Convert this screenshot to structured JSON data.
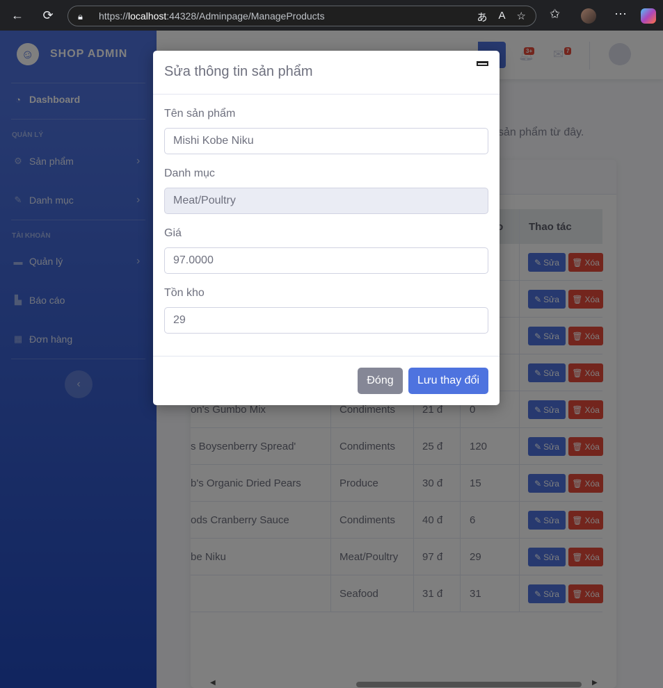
{
  "browser": {
    "url_prefix": "https://",
    "url_host": "localhost",
    "url_rest": ":44328/Adminpage/ManageProducts"
  },
  "sidebar": {
    "brand": "SHOP ADMIN",
    "dashboard": "Dashboard",
    "heading_manage": "QUẢN LÝ",
    "products": "Sản phẩm",
    "categories": "Danh mục",
    "heading_account": "TÀI KHOẢN",
    "manage": "Quản lý",
    "reports": "Báo cáo",
    "orders": "Đơn hàng"
  },
  "topbar": {
    "alerts_count": "3+",
    "messages_count": "7"
  },
  "content": {
    "description_tail": "sản phẩm từ đây."
  },
  "table": {
    "header_stock_tail": "ho",
    "header_actions": "Thao tác",
    "edit_label": "Sửa",
    "delete_label": "Xóa",
    "rows": [
      {
        "name": "",
        "category": "",
        "price": "",
        "stock": ""
      },
      {
        "name": "",
        "category": "",
        "price": "",
        "stock": ""
      },
      {
        "name": "",
        "category": "",
        "price": "",
        "stock": ""
      },
      {
        "name": "",
        "category": "",
        "price": "",
        "stock": ""
      },
      {
        "name": "on's Gumbo Mix",
        "category": "Condiments",
        "price": "21 đ",
        "stock": "0"
      },
      {
        "name": "'s Boysenberry Spread",
        "category": "Condiments",
        "price": "25 đ",
        "stock": "120"
      },
      {
        "name": "b's Organic Dried Pears",
        "category": "Produce",
        "price": "30 đ",
        "stock": "15"
      },
      {
        "name": "ods Cranberry Sauce",
        "category": "Condiments",
        "price": "40 đ",
        "stock": "6"
      },
      {
        "name": "be Niku",
        "category": "Meat/Poultry",
        "price": "97 đ",
        "stock": "29"
      },
      {
        "name": "",
        "category": "Seafood",
        "price": "31 đ",
        "stock": "31"
      }
    ]
  },
  "modal": {
    "title": "Sửa thông tin sản phẩm",
    "name_label": "Tên sản phẩm",
    "name_value": "Mishi Kobe Niku",
    "category_label": "Danh mục",
    "category_value": "Meat/Poultry",
    "price_label": "Giá",
    "price_value": "97.0000",
    "stock_label": "Tồn kho",
    "stock_value": "29",
    "close_button": "Đóng",
    "save_button": "Lưu thay đổi"
  }
}
